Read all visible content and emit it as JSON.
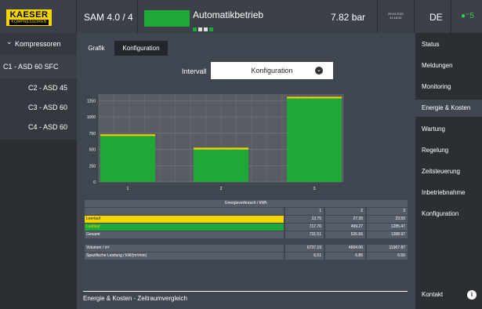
{
  "header": {
    "brand": "KAESER",
    "brand_sub": "KOMPRESSOREN",
    "machine": "SAM 4.0 / 4",
    "state": "Automatikbetrieb",
    "pressure": "7.82 bar",
    "date": "29.04.2021",
    "time": "11:18:02",
    "language": "DE",
    "user_count": "5"
  },
  "left_nav": {
    "header": "Kompressoren",
    "items": [
      "C1 - ASD 60 SFC",
      "C2 - ASD 45",
      "C3 - ASD 60",
      "C4 - ASD 60"
    ]
  },
  "tabs": [
    "Grafik",
    "Konfiguration"
  ],
  "interval": {
    "label": "Intervall",
    "value": "Konfiguration"
  },
  "chart_data": {
    "type": "bar",
    "categories": [
      "1",
      "2",
      "3"
    ],
    "series": [
      {
        "name": "Leerlauf",
        "values": [
          13.75,
          27.39,
          23.5
        ]
      },
      {
        "name": "Lastlauf",
        "values": [
          717.76,
          499.27,
          1285.47
        ]
      }
    ],
    "yticks": [
      0,
      250,
      500,
      750,
      1000,
      1250
    ],
    "ylim": [
      0,
      1350
    ],
    "colors": {
      "leerlauf": "#f5d400",
      "lastlauf": "#1fa83a"
    }
  },
  "table": {
    "title": "Energieverbrauch / kWh",
    "cols": [
      "1",
      "2",
      "3"
    ],
    "rows": [
      {
        "label": "Leerlauf",
        "values": [
          "13.75",
          "27.39",
          "23.50"
        ]
      },
      {
        "label": "Lastlauf",
        "values": [
          "717.76",
          "499.27",
          "1285.47"
        ]
      },
      {
        "label": "Gesamt",
        "values": [
          "731.51",
          "526.66",
          "1308.97"
        ]
      }
    ],
    "rows2": [
      {
        "label": "Volumen / m³",
        "values": [
          "6737.19",
          "4604.06",
          "11967.87"
        ]
      },
      {
        "label": "Spezifische Leistung / kW/(m³/min)",
        "values": [
          "6.51",
          "6.86",
          "6.56"
        ]
      }
    ]
  },
  "footer": "Energie & Kosten - Zeitraumvergleich",
  "right_nav": {
    "items": [
      "Status",
      "Meldungen",
      "Monitoring",
      "Energie & Kosten",
      "Wartung",
      "Regelung",
      "Zeitsteuerung",
      "Inbetriebnahme",
      "Konfiguration"
    ],
    "contact": "Kontakt"
  },
  "colors": {
    "accent_yellow": "#f5d400",
    "status_green": "#1fa83a",
    "panel": "#3f4650"
  }
}
